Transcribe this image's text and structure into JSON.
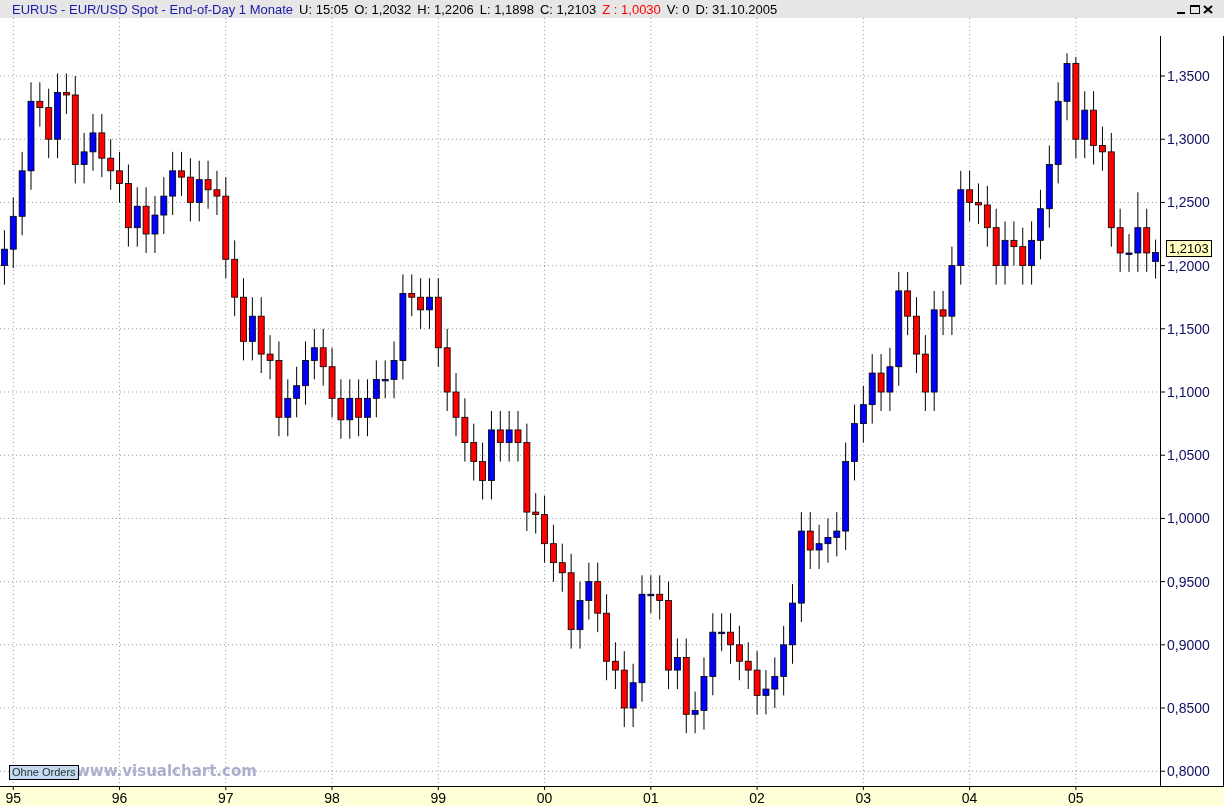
{
  "header": {
    "title": "EURUS - EUR/USD Spot - End-of-Day 1 Monate",
    "fields": [
      {
        "text": "U: 15:05",
        "color": "#000000"
      },
      {
        "text": "O: 1,2032",
        "color": "#000000"
      },
      {
        "text": "H: 1,2206",
        "color": "#000000"
      },
      {
        "text": "L: 1,1898",
        "color": "#000000"
      },
      {
        "text": "C: 1,2103",
        "color": "#000000"
      },
      {
        "text": "Z : 1,0030",
        "color": "#ff0000"
      },
      {
        "text": "V: 0",
        "color": "#000000"
      },
      {
        "text": "D: 31.10.2005",
        "color": "#000000"
      }
    ]
  },
  "chart": {
    "last_price": "1,2103",
    "order_button": "Ohne Orders",
    "branding": "www.visualchart.com",
    "chart_data": {
      "type": "candlestick",
      "grid": true,
      "ylim": [
        0.7883,
        1.3959
      ],
      "yticks": [
        {
          "value": 0.8,
          "label": "0,8000"
        },
        {
          "value": 0.85,
          "label": "0,8500"
        },
        {
          "value": 0.9,
          "label": "0,9000"
        },
        {
          "value": 0.95,
          "label": "0,9500"
        },
        {
          "value": 1.0,
          "label": "1,0000"
        },
        {
          "value": 1.05,
          "label": "1,0500"
        },
        {
          "value": 1.1,
          "label": "1,1000"
        },
        {
          "value": 1.15,
          "label": "1,1500"
        },
        {
          "value": 1.2,
          "label": "1,2000"
        },
        {
          "value": 1.25,
          "label": "1,2500"
        },
        {
          "value": 1.3,
          "label": "1,3000"
        },
        {
          "value": 1.35,
          "label": "1,3500"
        }
      ],
      "categories": [
        null,
        "95",
        null,
        null,
        null,
        null,
        null,
        null,
        null,
        null,
        null,
        null,
        null,
        "96",
        null,
        null,
        null,
        null,
        null,
        null,
        null,
        null,
        null,
        null,
        null,
        "97",
        null,
        null,
        null,
        null,
        null,
        null,
        null,
        null,
        null,
        null,
        null,
        "98",
        null,
        null,
        null,
        null,
        null,
        null,
        null,
        null,
        null,
        null,
        null,
        "99",
        null,
        null,
        null,
        null,
        null,
        null,
        null,
        null,
        null,
        null,
        null,
        "00",
        null,
        null,
        null,
        null,
        null,
        null,
        null,
        null,
        null,
        null,
        null,
        "01",
        null,
        null,
        null,
        null,
        null,
        null,
        null,
        null,
        null,
        null,
        null,
        "02",
        null,
        null,
        null,
        null,
        null,
        null,
        null,
        null,
        null,
        null,
        null,
        "03",
        null,
        null,
        null,
        null,
        null,
        null,
        null,
        null,
        null,
        null,
        null,
        "04",
        null,
        null,
        null,
        null,
        null,
        null,
        null,
        null,
        null,
        null,
        null,
        "05",
        null,
        null,
        null,
        null,
        null,
        null,
        null,
        null,
        null
      ],
      "ohlc": [
        [
          1.2,
          1.228,
          1.185,
          1.213
        ],
        [
          1.213,
          1.254,
          1.198,
          1.239
        ],
        [
          1.239,
          1.29,
          1.224,
          1.275
        ],
        [
          1.275,
          1.345,
          1.26,
          1.33
        ],
        [
          1.33,
          1.345,
          1.31,
          1.325
        ],
        [
          1.325,
          1.34,
          1.285,
          1.3
        ],
        [
          1.3,
          1.352,
          1.285,
          1.337
        ],
        [
          1.337,
          1.352,
          1.32,
          1.335
        ],
        [
          1.335,
          1.35,
          1.265,
          1.28
        ],
        [
          1.28,
          1.305,
          1.265,
          1.29
        ],
        [
          1.29,
          1.32,
          1.275,
          1.305
        ],
        [
          1.305,
          1.32,
          1.27,
          1.285
        ],
        [
          1.285,
          1.3,
          1.26,
          1.275
        ],
        [
          1.275,
          1.29,
          1.25,
          1.265
        ],
        [
          1.265,
          1.28,
          1.215,
          1.23
        ],
        [
          1.23,
          1.262,
          1.215,
          1.247
        ],
        [
          1.247,
          1.262,
          1.21,
          1.225
        ],
        [
          1.225,
          1.255,
          1.21,
          1.24
        ],
        [
          1.24,
          1.27,
          1.225,
          1.255
        ],
        [
          1.255,
          1.29,
          1.24,
          1.275
        ],
        [
          1.275,
          1.29,
          1.255,
          1.27
        ],
        [
          1.27,
          1.285,
          1.235,
          1.25
        ],
        [
          1.25,
          1.283,
          1.235,
          1.268
        ],
        [
          1.268,
          1.283,
          1.245,
          1.26
        ],
        [
          1.26,
          1.275,
          1.24,
          1.255
        ],
        [
          1.255,
          1.27,
          1.19,
          1.205
        ],
        [
          1.205,
          1.22,
          1.16,
          1.175
        ],
        [
          1.175,
          1.19,
          1.125,
          1.14
        ],
        [
          1.14,
          1.175,
          1.125,
          1.16
        ],
        [
          1.16,
          1.175,
          1.115,
          1.13
        ],
        [
          1.13,
          1.145,
          1.11,
          1.125
        ],
        [
          1.125,
          1.14,
          1.065,
          1.08
        ],
        [
          1.08,
          1.11,
          1.065,
          1.095
        ],
        [
          1.095,
          1.12,
          1.08,
          1.105
        ],
        [
          1.105,
          1.14,
          1.09,
          1.125
        ],
        [
          1.125,
          1.15,
          1.11,
          1.135
        ],
        [
          1.135,
          1.15,
          1.105,
          1.12
        ],
        [
          1.12,
          1.135,
          1.08,
          1.095
        ],
        [
          1.095,
          1.11,
          1.063,
          1.078
        ],
        [
          1.078,
          1.11,
          1.063,
          1.095
        ],
        [
          1.095,
          1.11,
          1.065,
          1.08
        ],
        [
          1.08,
          1.11,
          1.065,
          1.095
        ],
        [
          1.095,
          1.125,
          1.08,
          1.11
        ],
        [
          1.11,
          1.125,
          1.095,
          1.11
        ],
        [
          1.11,
          1.14,
          1.095,
          1.125
        ],
        [
          1.125,
          1.193,
          1.11,
          1.178
        ],
        [
          1.178,
          1.193,
          1.16,
          1.175
        ],
        [
          1.175,
          1.19,
          1.15,
          1.165
        ],
        [
          1.165,
          1.19,
          1.15,
          1.175
        ],
        [
          1.175,
          1.19,
          1.12,
          1.135
        ],
        [
          1.135,
          1.15,
          1.085,
          1.1
        ],
        [
          1.1,
          1.115,
          1.065,
          1.08
        ],
        [
          1.08,
          1.095,
          1.045,
          1.06
        ],
        [
          1.06,
          1.075,
          1.03,
          1.045
        ],
        [
          1.045,
          1.06,
          1.015,
          1.03
        ],
        [
          1.03,
          1.085,
          1.015,
          1.07
        ],
        [
          1.07,
          1.085,
          1.045,
          1.06
        ],
        [
          1.06,
          1.085,
          1.045,
          1.07
        ],
        [
          1.07,
          1.085,
          1.045,
          1.06
        ],
        [
          1.06,
          1.075,
          0.99,
          1.005
        ],
        [
          1.005,
          1.02,
          0.988,
          1.003
        ],
        [
          1.003,
          1.018,
          0.965,
          0.98
        ],
        [
          0.98,
          0.995,
          0.95,
          0.965
        ],
        [
          0.965,
          0.98,
          0.942,
          0.957
        ],
        [
          0.957,
          0.972,
          0.897,
          0.912
        ],
        [
          0.912,
          0.95,
          0.897,
          0.935
        ],
        [
          0.935,
          0.965,
          0.92,
          0.95
        ],
        [
          0.95,
          0.965,
          0.91,
          0.925
        ],
        [
          0.925,
          0.94,
          0.872,
          0.887
        ],
        [
          0.887,
          0.902,
          0.865,
          0.88
        ],
        [
          0.88,
          0.895,
          0.835,
          0.85
        ],
        [
          0.85,
          0.885,
          0.835,
          0.87
        ],
        [
          0.87,
          0.955,
          0.855,
          0.94
        ],
        [
          0.94,
          0.955,
          0.925,
          0.94
        ],
        [
          0.94,
          0.955,
          0.92,
          0.935
        ],
        [
          0.935,
          0.95,
          0.865,
          0.88
        ],
        [
          0.88,
          0.905,
          0.865,
          0.89
        ],
        [
          0.89,
          0.905,
          0.83,
          0.845
        ],
        [
          0.845,
          0.863,
          0.83,
          0.848
        ],
        [
          0.848,
          0.89,
          0.833,
          0.875
        ],
        [
          0.875,
          0.925,
          0.86,
          0.91
        ],
        [
          0.91,
          0.925,
          0.895,
          0.91
        ],
        [
          0.91,
          0.925,
          0.885,
          0.9
        ],
        [
          0.9,
          0.915,
          0.872,
          0.887
        ],
        [
          0.887,
          0.902,
          0.865,
          0.88
        ],
        [
          0.88,
          0.895,
          0.845,
          0.86
        ],
        [
          0.86,
          0.88,
          0.845,
          0.865
        ],
        [
          0.865,
          0.89,
          0.85,
          0.875
        ],
        [
          0.875,
          0.915,
          0.86,
          0.9
        ],
        [
          0.9,
          0.948,
          0.885,
          0.933
        ],
        [
          0.933,
          1.005,
          0.918,
          0.99
        ],
        [
          0.99,
          1.005,
          0.96,
          0.975
        ],
        [
          0.975,
          0.995,
          0.96,
          0.98
        ],
        [
          0.98,
          1.0,
          0.965,
          0.985
        ],
        [
          0.985,
          1.005,
          0.97,
          0.99
        ],
        [
          0.99,
          1.06,
          0.975,
          1.045
        ],
        [
          1.045,
          1.09,
          1.03,
          1.075
        ],
        [
          1.075,
          1.105,
          1.06,
          1.09
        ],
        [
          1.09,
          1.13,
          1.075,
          1.115
        ],
        [
          1.115,
          1.13,
          1.085,
          1.1
        ],
        [
          1.1,
          1.135,
          1.085,
          1.12
        ],
        [
          1.12,
          1.195,
          1.105,
          1.18
        ],
        [
          1.18,
          1.195,
          1.145,
          1.16
        ],
        [
          1.16,
          1.175,
          1.115,
          1.13
        ],
        [
          1.13,
          1.145,
          1.085,
          1.1
        ],
        [
          1.1,
          1.18,
          1.085,
          1.165
        ],
        [
          1.165,
          1.18,
          1.145,
          1.16
        ],
        [
          1.16,
          1.215,
          1.145,
          1.2
        ],
        [
          1.2,
          1.275,
          1.185,
          1.26
        ],
        [
          1.26,
          1.275,
          1.235,
          1.25
        ],
        [
          1.25,
          1.265,
          1.233,
          1.248
        ],
        [
          1.248,
          1.263,
          1.215,
          1.23
        ],
        [
          1.23,
          1.245,
          1.185,
          1.2
        ],
        [
          1.2,
          1.235,
          1.185,
          1.22
        ],
        [
          1.22,
          1.235,
          1.2,
          1.215
        ],
        [
          1.215,
          1.23,
          1.185,
          1.2
        ],
        [
          1.2,
          1.235,
          1.185,
          1.22
        ],
        [
          1.22,
          1.26,
          1.205,
          1.245
        ],
        [
          1.245,
          1.295,
          1.23,
          1.28
        ],
        [
          1.28,
          1.345,
          1.265,
          1.33
        ],
        [
          1.33,
          1.368,
          1.315,
          1.36
        ],
        [
          1.36,
          1.365,
          1.285,
          1.3
        ],
        [
          1.3,
          1.338,
          1.285,
          1.323
        ],
        [
          1.323,
          1.338,
          1.28,
          1.295
        ],
        [
          1.295,
          1.31,
          1.275,
          1.29
        ],
        [
          1.29,
          1.305,
          1.215,
          1.23
        ],
        [
          1.23,
          1.245,
          1.195,
          1.21
        ],
        [
          1.21,
          1.225,
          1.195,
          1.21
        ],
        [
          1.21,
          1.258,
          1.195,
          1.23
        ],
        [
          1.23,
          1.245,
          1.195,
          1.21
        ],
        [
          1.2032,
          1.2206,
          1.1898,
          1.2103
        ]
      ]
    }
  }
}
